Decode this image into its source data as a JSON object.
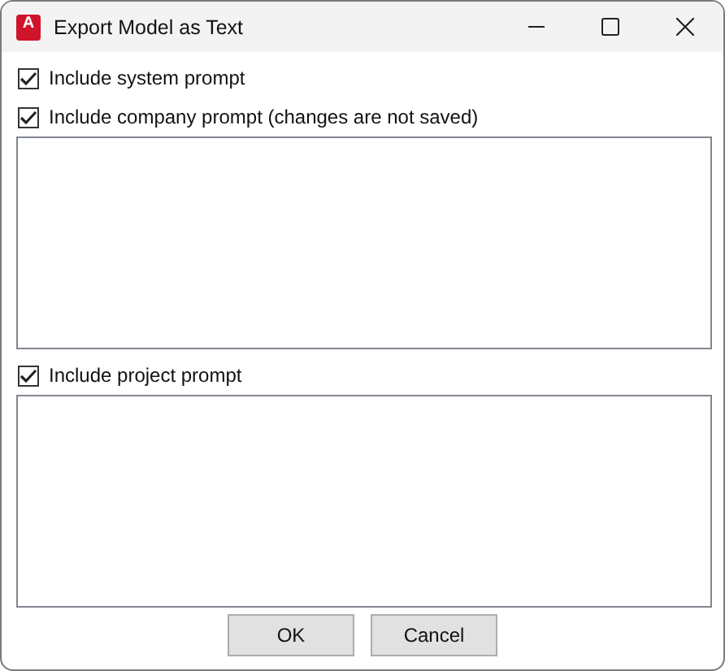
{
  "window": {
    "title": "Export Model as Text",
    "icon_letter": "A"
  },
  "items": [
    {
      "kind": "checkbox",
      "label": "Include system prompt",
      "checked": true
    },
    {
      "kind": "checkbox",
      "label": "Include company prompt (changes are not saved)",
      "checked": true
    },
    {
      "kind": "text_area"
    },
    {
      "kind": "checkbox",
      "label": "Include project prompt",
      "checked": true
    },
    {
      "kind": "text_area"
    }
  ],
  "buttons": [
    "OK",
    "Cancel"
  ]
}
